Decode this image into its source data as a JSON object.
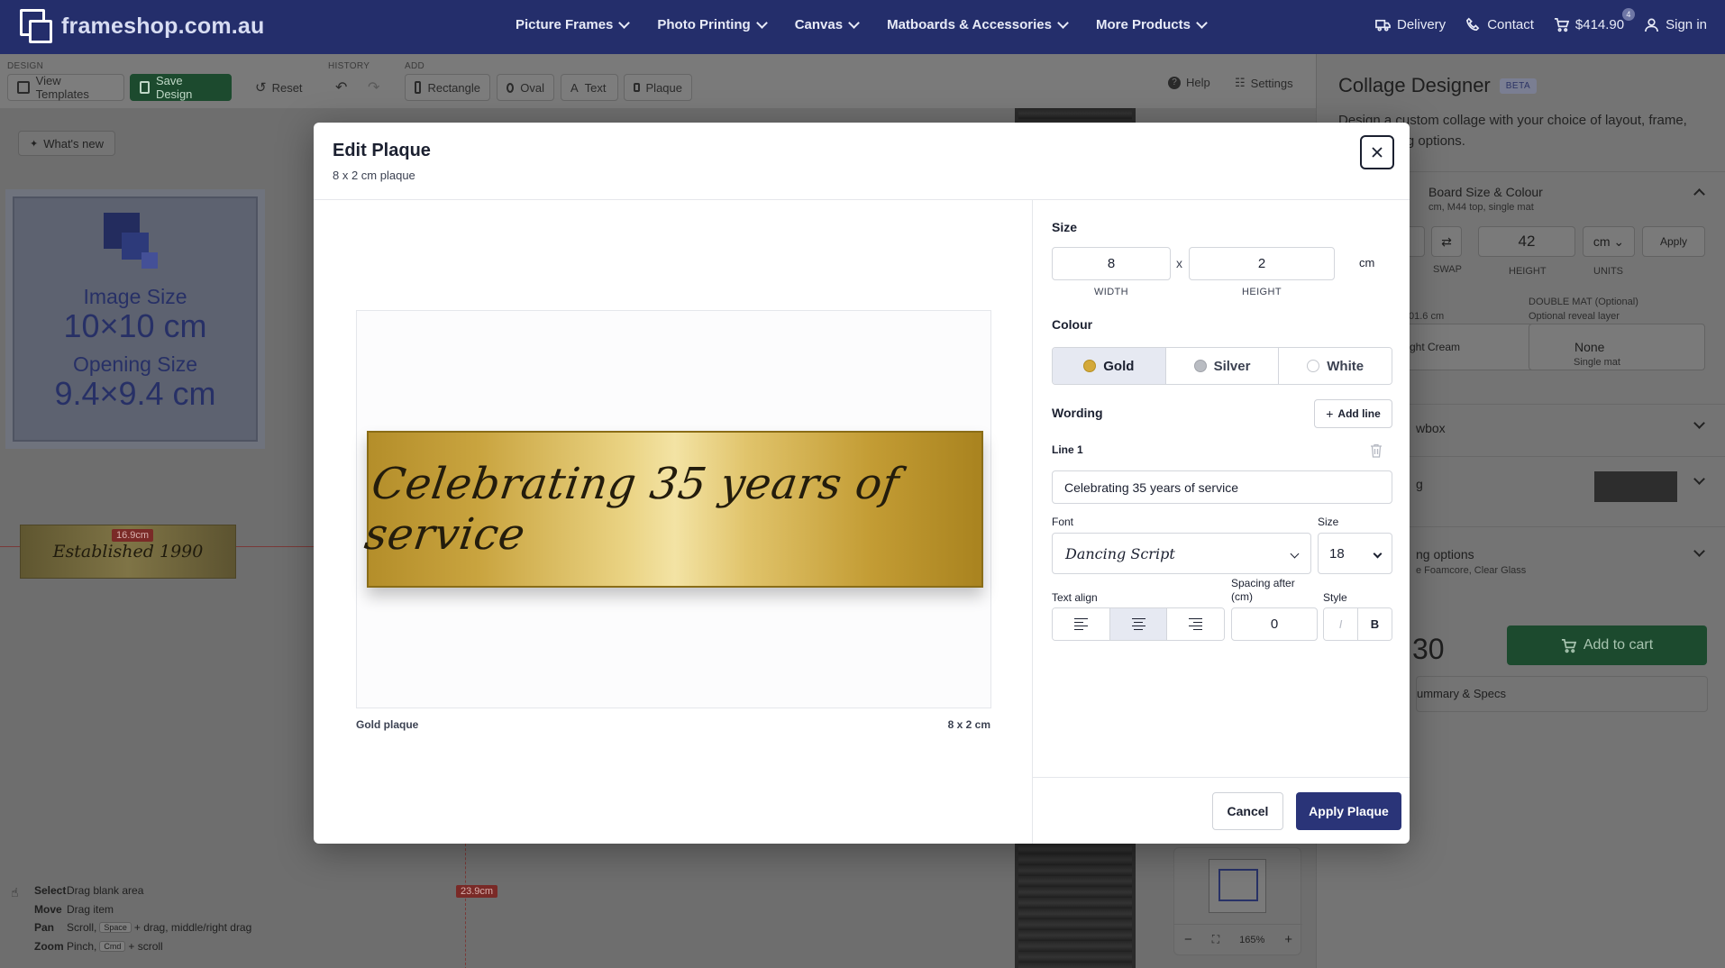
{
  "site": {
    "logo_text": "frameshop.com.au",
    "nav": [
      "Picture Frames",
      "Photo Printing",
      "Canvas",
      "Matboards & Accessories",
      "More Products"
    ],
    "delivery": "Delivery",
    "contact": "Contact",
    "cart_total": "$414.90",
    "cart_count": "4",
    "sign_in": "Sign in"
  },
  "toolbar": {
    "design_label": "DESIGN",
    "history_label": "HISTORY",
    "add_label": "ADD",
    "view_templates": "View Templates",
    "save_design": "Save Design",
    "reset": "Reset",
    "rectangle": "Rectangle",
    "oval": "Oval",
    "text": "Text",
    "plaque": "Plaque",
    "help": "Help",
    "settings": "Settings"
  },
  "canvas": {
    "whats_new": "What's new",
    "image_size_label": "Image Size",
    "image_size_value": "10×10 cm",
    "opening_size_label": "Opening Size",
    "opening_size_value": "9.4×9.4 cm",
    "mini_plaque_text": "Established 1990",
    "dim_horizontal": "16.9cm",
    "dim_vertical": "23.9cm",
    "zoom_level": "165%",
    "help": [
      {
        "key": "Select",
        "desc": "Drag blank area"
      },
      {
        "key": "Move",
        "desc": "Drag item"
      },
      {
        "key": "Pan",
        "desc_pre": "Scroll,",
        "kbd": "Space",
        "desc_post": "+ drag, middle/right drag"
      },
      {
        "key": "Zoom",
        "desc_pre": "Pinch,",
        "kbd": "Cmd",
        "desc_post": "+ scroll"
      }
    ]
  },
  "sidebar": {
    "title": "Collage Designer",
    "badge": "BETA",
    "description": "Design a custom collage with your choice of layout, frame, and finishing options.",
    "board_title": "Board Size & Colour",
    "board_sub": "cm, M44 top, single mat",
    "swap_label": "SWAP",
    "height_value": "42",
    "height_label": "HEIGHT",
    "units_value": "cm",
    "units_label": "UNITS",
    "apply": "Apply",
    "mat_sub": "01.6 cm",
    "mat_colour": "ght Cream",
    "double_mat_label": "DOUBLE MAT",
    "double_mat_optional": "(Optional)",
    "double_mat_sub": "Optional reveal layer",
    "double_mat_value": "None",
    "double_mat_value_sub": "Single mat",
    "shadowbox": "wbox",
    "framing": "g",
    "finishing": "ng options",
    "finishing_sub": "e Foamcore, Clear Glass",
    "price_partial": "30",
    "add_to_cart": "Add to cart",
    "summary": "ummary & Specs"
  },
  "modal": {
    "title": "Edit Plaque",
    "subtitle": "8 x 2 cm plaque",
    "preview_text": "Celebrating 35 years of service",
    "preview_caption_left": "Gold plaque",
    "preview_caption_right": "8 x 2 cm",
    "size_label": "Size",
    "width_value": "8",
    "width_label": "WIDTH",
    "times": "x",
    "height_value": "2",
    "height_label": "HEIGHT",
    "unit": "cm",
    "colour_label": "Colour",
    "colours": [
      {
        "name": "Gold",
        "hex": "#d4a93a",
        "active": true
      },
      {
        "name": "Silver",
        "hex": "#b9bcc2",
        "active": false
      },
      {
        "name": "White",
        "hex": "#ffffff",
        "active": false
      }
    ],
    "wording_label": "Wording",
    "add_line": "Add line",
    "line1_label": "Line 1",
    "line1_value": "Celebrating 35 years of service",
    "font_label": "Font",
    "font_value": "Dancing Script",
    "size_small_label": "Size",
    "font_size_value": "18",
    "text_align_label": "Text align",
    "spacing_label_1": "Spacing after",
    "spacing_label_2": "(cm)",
    "spacing_value": "0",
    "style_label": "Style",
    "italic": "I",
    "bold": "B",
    "cancel": "Cancel",
    "apply": "Apply Plaque"
  },
  "colors": {
    "brand_navy": "#242e6b",
    "primary_button": "#2a3478",
    "save_green": "#1c4a2e",
    "plaque_gold": "#d4a93a"
  }
}
